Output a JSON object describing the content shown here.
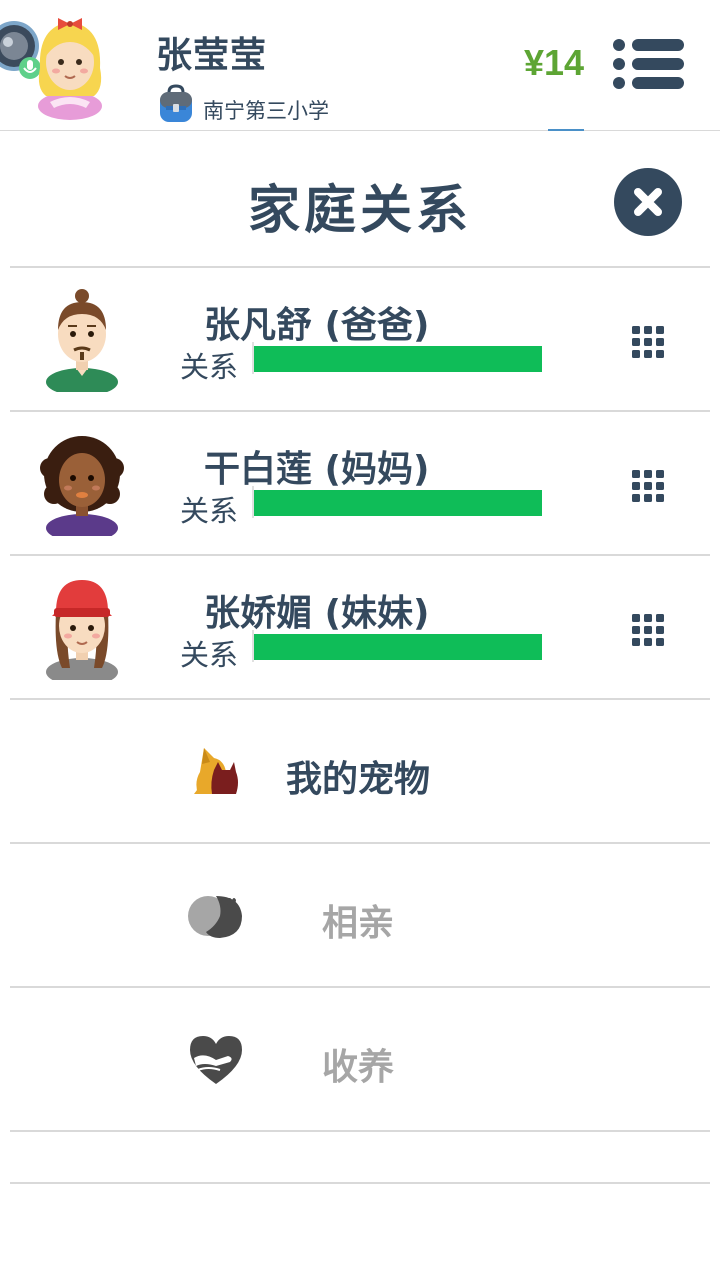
{
  "header": {
    "player_name": "张莹莹",
    "school": "南宁第三小学",
    "money": "¥14"
  },
  "page": {
    "title": "家庭关系"
  },
  "family": [
    {
      "name": "张凡舒 (爸爸)",
      "relation_label": "关系",
      "relation_level": 1.0,
      "avatar": "father-avatar"
    },
    {
      "name": "干白莲 (妈妈)",
      "relation_label": "关系",
      "relation_level": 1.0,
      "avatar": "mother-avatar"
    },
    {
      "name": "张娇媚 (妹妹)",
      "relation_label": "关系",
      "relation_level": 1.0,
      "avatar": "sister-avatar"
    }
  ],
  "menu": [
    {
      "label": "我的宠物",
      "icon": "pet-icon",
      "enabled": true
    },
    {
      "label": "相亲",
      "icon": "dating-icon",
      "enabled": false
    },
    {
      "label": "收养",
      "icon": "adoption-icon",
      "enabled": false
    }
  ],
  "colors": {
    "primary": "#34495e",
    "money": "#5da534",
    "relation_bar": "#0fbd58",
    "disabled": "#a6a6a6",
    "divider": "#d9d9d9"
  }
}
